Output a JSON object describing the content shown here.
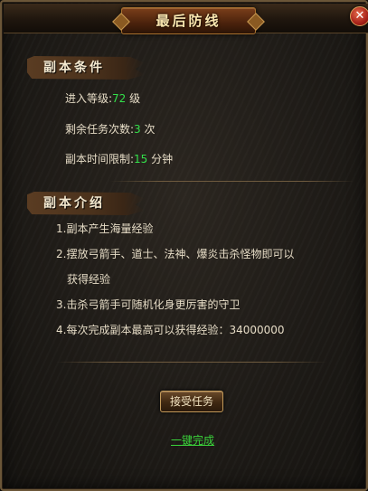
{
  "dialog": {
    "title": "最后防线",
    "close_icon": "✕"
  },
  "conditions": {
    "heading": "副本条件",
    "rows": [
      {
        "label": "进入等级:",
        "value": "72",
        "suffix": " 级"
      },
      {
        "label": "剩余任务次数:",
        "value": "3",
        "suffix": " 次"
      },
      {
        "label": "副本时间限制:",
        "value": "15",
        "suffix": " 分钟"
      }
    ]
  },
  "intro": {
    "heading": "副本介绍",
    "items": [
      "1.副本产生海量经验",
      "2.摆放弓箭手、道士、法神、爆炎击杀怪物即可以",
      "获得经验",
      "3.击杀弓箭手可随机化身更厉害的守卫",
      "4.每次完成副本最高可以获得经验：34000000"
    ]
  },
  "actions": {
    "accept_label": "接受任务",
    "oneclick_label": "一键完成"
  },
  "colors": {
    "value_green": "#33e04a",
    "link_green": "#3ad23a",
    "title_text": "#fbe7b0"
  }
}
